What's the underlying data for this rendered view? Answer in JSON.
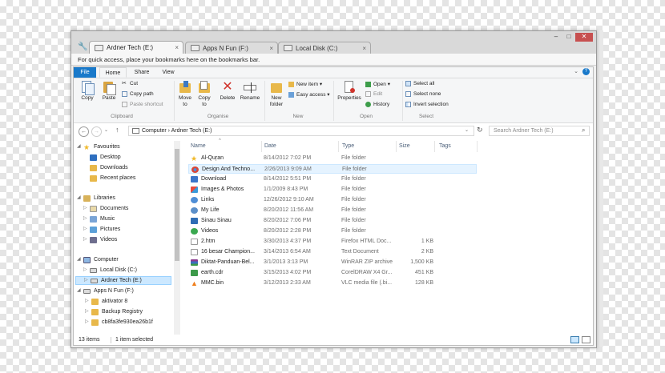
{
  "tabs": [
    {
      "label": "Ardner Tech (E:)",
      "close": "×"
    },
    {
      "label": "Apps N Fun (F:)",
      "close": "×"
    },
    {
      "label": "Local Disk (C:)",
      "close": "×"
    }
  ],
  "window_controls": {
    "minimize": "–",
    "maximize": "□",
    "close": "✕"
  },
  "bookmark_bar_text": "For quick access, place your bookmarks here on the bookmarks bar.",
  "ribbon_tabs": [
    "File",
    "Home",
    "Share",
    "View"
  ],
  "ribbon": {
    "clipboard": {
      "copy": "Copy",
      "paste": "Paste",
      "cut": "Cut",
      "copy_path": "Copy path",
      "paste_shortcut": "Paste shortcut",
      "label": "Clipboard"
    },
    "organise": {
      "move_to": "Move to",
      "copy_to": "Copy to",
      "delete": "Delete",
      "rename": "Rename",
      "label": "Organise"
    },
    "new": {
      "new_folder": "New folder",
      "new_item": "New item ▾",
      "easy_access": "Easy access ▾",
      "label": "New"
    },
    "open": {
      "properties": "Properties",
      "open": "Open ▾",
      "edit": "Edit",
      "history": "History",
      "label": "Open"
    },
    "select": {
      "select_all": "Select all",
      "select_none": "Select none",
      "invert_selection": "Invert selection",
      "label": "Select"
    }
  },
  "address": {
    "path": "Computer  ›  Ardner Tech (E:)",
    "search_placeholder": "Search Ardner Tech (E:)"
  },
  "nav_tree": [
    {
      "label": "Favourites"
    },
    {
      "label": "Desktop"
    },
    {
      "label": "Downloads"
    },
    {
      "label": "Recent places"
    },
    {
      "label": "Libraries"
    },
    {
      "label": "Documents"
    },
    {
      "label": "Music"
    },
    {
      "label": "Pictures"
    },
    {
      "label": "Videos"
    },
    {
      "label": "Computer"
    },
    {
      "label": "Local Disk (C:)"
    },
    {
      "label": "Ardner Tech (E:)"
    },
    {
      "label": "Apps N Fun (F:)"
    },
    {
      "label": "aktivator 8"
    },
    {
      "label": "Backup Registry"
    },
    {
      "label": "cb8fa3fe930ea26b1f"
    }
  ],
  "columns": {
    "name": "Name",
    "date": "Date",
    "type": "Type",
    "size": "Size",
    "tags": "Tags"
  },
  "files": [
    {
      "name": "Al-Qur̦an",
      "date": "8/14/2012 7:02 PM",
      "type": "File folder",
      "size": ""
    },
    {
      "name": "Design And Techno...",
      "date": "2/26/2013 9:09 AM",
      "type": "File folder",
      "size": ""
    },
    {
      "name": "Download",
      "date": "8/14/2012 5:51 PM",
      "type": "File folder",
      "size": ""
    },
    {
      "name": "Images & Photos",
      "date": "1/1/2009 8:43 PM",
      "type": "File folder",
      "size": ""
    },
    {
      "name": "Links",
      "date": "12/26/2012 9:10 AM",
      "type": "File folder",
      "size": ""
    },
    {
      "name": "My Life",
      "date": "8/20/2012 11:56 AM",
      "type": "File folder",
      "size": ""
    },
    {
      "name": "Sinau Sinau",
      "date": "8/20/2012 7:06 PM",
      "type": "File folder",
      "size": ""
    },
    {
      "name": "Videos",
      "date": "8/20/2012 2:28 PM",
      "type": "File folder",
      "size": ""
    },
    {
      "name": "2.htm",
      "date": "3/30/2013 4:37 PM",
      "type": "Firefox HTML Doc...",
      "size": "1 KB"
    },
    {
      "name": "16 besar Champion...",
      "date": "3/14/2013 6:54 AM",
      "type": "Text Document",
      "size": "2 KB"
    },
    {
      "name": "Diktat-Panduan-Bel...",
      "date": "3/1/2013 3:13 PM",
      "type": "WinRAR ZIP archive",
      "size": "1,500 KB"
    },
    {
      "name": "earth.cdr",
      "date": "3/15/2013 4:02 PM",
      "type": "CorelDRAW X4 Gr...",
      "size": "451 KB"
    },
    {
      "name": "MMC.bin",
      "date": "3/12/2013 2:33 AM",
      "type": "VLC media file (.bi...",
      "size": "128 KB"
    }
  ],
  "status": {
    "items": "13 items",
    "selected": "1 item selected"
  }
}
